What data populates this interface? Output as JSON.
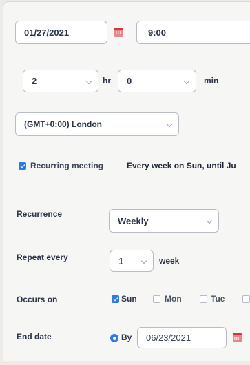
{
  "schedule": {
    "date_value": "01/27/2021",
    "time_value": "9:00"
  },
  "duration": {
    "hours_value": "2",
    "hours_unit": "hr",
    "minutes_value": "0",
    "minutes_unit": "min"
  },
  "timezone": {
    "value": "(GMT+0:00) London"
  },
  "recurring": {
    "checkbox_label": "Recurring meeting",
    "checked": true,
    "summary": "Every week on Sun, until Ju"
  },
  "recurrence": {
    "label": "Recurrence",
    "value": "Weekly"
  },
  "repeat": {
    "label": "Repeat every",
    "value": "1",
    "unit": "week"
  },
  "occurs_on": {
    "label": "Occurs on",
    "days": [
      {
        "label": "Sun",
        "checked": true
      },
      {
        "label": "Mon",
        "checked": false
      },
      {
        "label": "Tue",
        "checked": false
      }
    ]
  },
  "end_date": {
    "label": "End date",
    "option_label": "By",
    "value": "06/23/2021"
  },
  "colors": {
    "accent": "#2d7be5",
    "calendar_icon": "#d3343f"
  },
  "icons": [
    "calendar-icon",
    "chevron-down-icon",
    "checkbox-icon",
    "radio-icon"
  ]
}
